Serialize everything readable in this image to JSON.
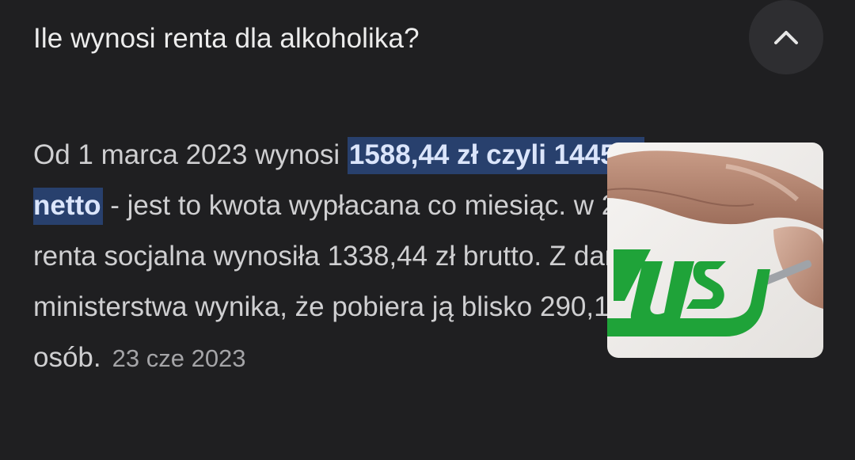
{
  "question": {
    "title": "Ile wynosi renta dla alkoholika?",
    "toggle_icon": "chevron-up-icon"
  },
  "answer": {
    "text_before": "Od 1 marca 2023 wynosi ",
    "highlight": "1588,44 zł czyli 1445 zł netto",
    "text_after": " - jest to kwota wypłacana co miesiąc. w 2022 renta socjalna wynosiła 1338,44 zł brutto. Z danych ministerstwa wynika, że pobiera ją blisko 290,1 tys. osób.",
    "date": "23 cze 2023",
    "highlight_color": "#28406d"
  },
  "thumbnail": {
    "logo_text": "ZUS",
    "logo_color": "#1fa339"
  }
}
